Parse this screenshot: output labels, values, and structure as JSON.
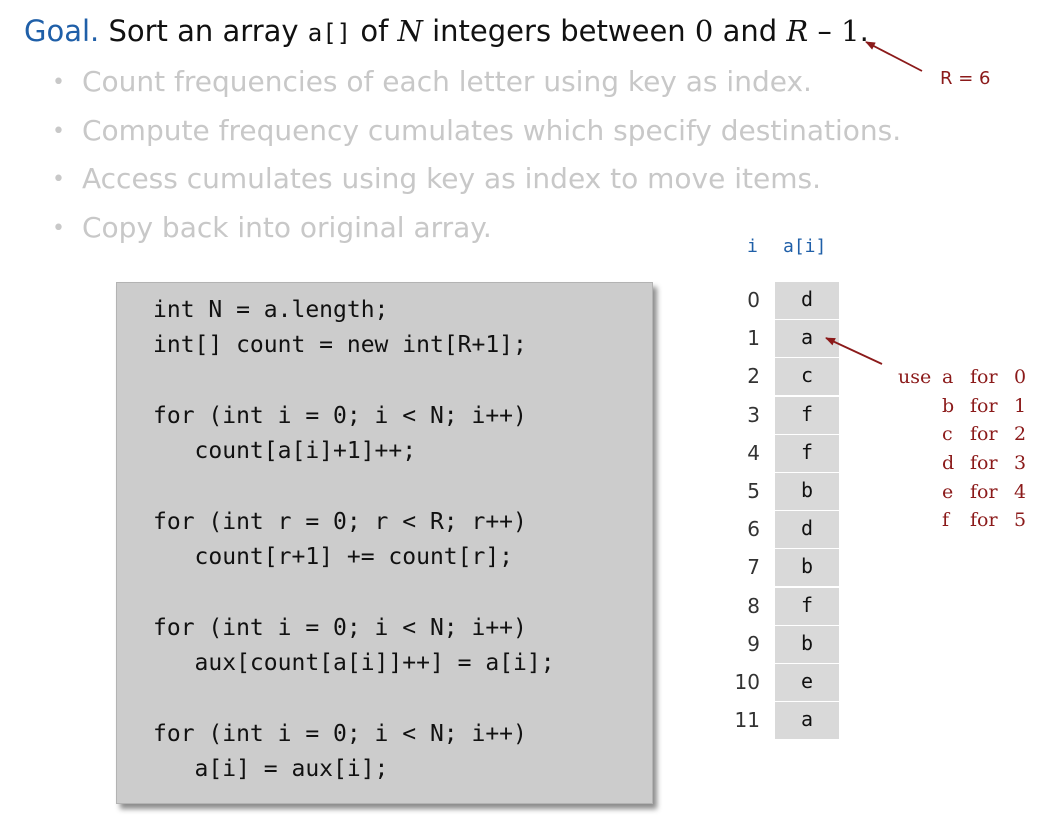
{
  "goal": {
    "word": "Goal.",
    "t1": " Sort an array ",
    "code": "a[]",
    "t2": " of ",
    "N": "N",
    "t3": " integers between ",
    "zero": "0",
    "t4": " and ",
    "R": "R",
    "t5": " – ",
    "one": "1",
    "t6": "."
  },
  "bullets": [
    "Count frequencies of each letter using key as index.",
    "Compute frequency cumulates which specify destinations.",
    "Access cumulates using key as index to move items.",
    "Copy back into original array."
  ],
  "r_annotation": "R = 6",
  "code_lines": [
    "int N = a.length;",
    "int[] count = new int[R+1];",
    "",
    "for (int i = 0; i < N; i++)",
    "   count[a[i]+1]++;",
    "",
    "for (int r = 0; r < R; r++)",
    "   count[r+1] += count[r];",
    "",
    "for (int i = 0; i < N; i++)",
    "   aux[count[a[i]]++] = a[i];",
    "",
    "for (int i = 0; i < N; i++)",
    "   a[i] = aux[i];"
  ],
  "array": {
    "index_header": "i",
    "value_header": "a[i]",
    "indices": [
      "0",
      "1",
      "2",
      "3",
      "4",
      "5",
      "6",
      "7",
      "8",
      "9",
      "10",
      "11"
    ],
    "values": [
      "d",
      "a",
      "c",
      "f",
      "f",
      "b",
      "d",
      "b",
      "f",
      "b",
      "e",
      "a"
    ]
  },
  "mapping": {
    "use_label": "use",
    "for_label": "for",
    "rows": [
      {
        "letter": "a",
        "num": "0"
      },
      {
        "letter": "b",
        "num": "1"
      },
      {
        "letter": "c",
        "num": "2"
      },
      {
        "letter": "d",
        "num": "3"
      },
      {
        "letter": "e",
        "num": "4"
      },
      {
        "letter": "f",
        "num": "5"
      }
    ]
  },
  "colors": {
    "goal_blue": "#1f5fa8",
    "annotation_red": "#8b1a1a",
    "faded_gray": "#c8c8c8",
    "code_box": "#cccccc",
    "cell_fill": "#d9d9d9"
  }
}
